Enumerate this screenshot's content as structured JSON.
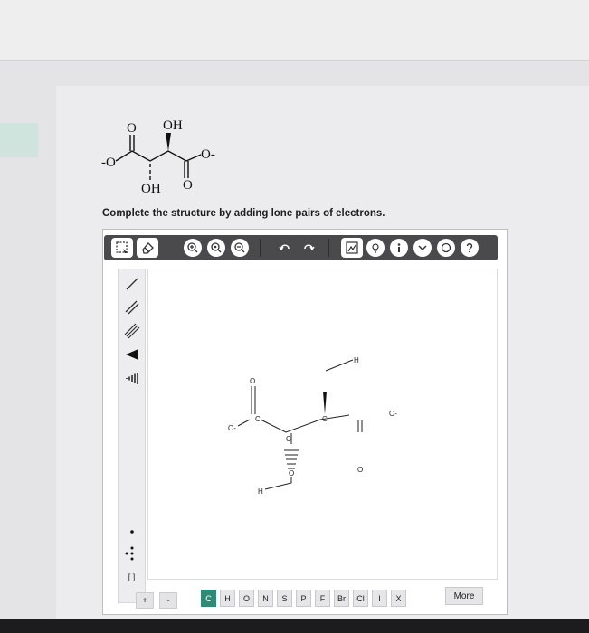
{
  "given_structure": {
    "labels": [
      "O",
      "OH",
      "-O",
      "O-",
      "OH",
      "O"
    ]
  },
  "instructions": "Complete the structure by adding lone pairs of electrons.",
  "toolbar": {
    "icons": [
      "select-lasso-icon",
      "eraser-icon",
      "zoom-in-icon",
      "zoom-reset-icon",
      "zoom-out-icon",
      "undo-icon",
      "redo-icon",
      "template-icon",
      "clean-structure-icon",
      "info-icon",
      "expand-icon",
      "ring-icon",
      "help-icon"
    ]
  },
  "left_tools": {
    "icons": [
      "single-bond-icon",
      "double-bond-icon",
      "triple-bond-icon",
      "wedge-bond-icon",
      "hash-bond-icon",
      "lone-pair-dot-icon",
      "lone-pair-icon",
      "bracket-icon"
    ],
    "bracket_label": "[ ]"
  },
  "canvas_atoms": [
    "O",
    "C",
    "O-",
    "O",
    "C",
    "H",
    "H",
    "C",
    "O-",
    "O"
  ],
  "charge_buttons": [
    "+",
    "-"
  ],
  "elements": [
    "C",
    "H",
    "O",
    "N",
    "S",
    "P",
    "F",
    "Br",
    "Cl",
    "I",
    "X"
  ],
  "more_label": "More",
  "colors": {
    "active_element": "#2f8b76",
    "toolbar": "#4a4a4d"
  }
}
